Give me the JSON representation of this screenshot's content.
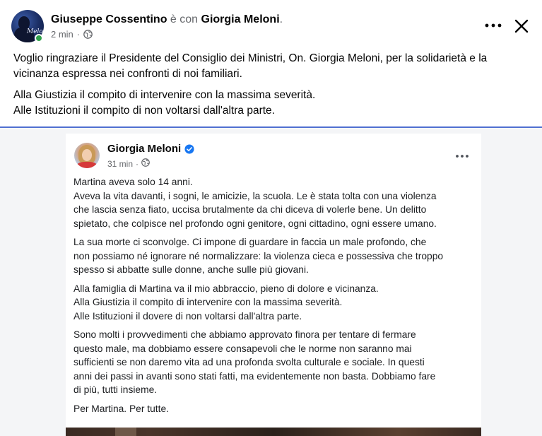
{
  "post": {
    "author": "Giuseppe Cossentino",
    "with_text": "è con",
    "tagged": "Giorgia Meloni",
    "period": ".",
    "time": "2 min",
    "dot": "·",
    "avatar_caption": "Meloni",
    "paragraphs": [
      "Voglio ringraziare il Presidente del Consiglio dei Ministri, On. Giorgia Meloni, per la solidarietà e la vicinanza espressa nei confronti di noi familiari.",
      "Alla Giustizia il compito di intervenire con la massima severità.",
      "Alle Istituzioni il compito di non voltarsi dall'altra parte."
    ]
  },
  "embed": {
    "author": "Giorgia Meloni",
    "time": "31 min",
    "dot": "·",
    "lines": {
      "p1": [
        "Martina aveva solo 14 anni.",
        "Aveva la vita davanti, i sogni, le amicizie, la scuola. Le è stata tolta con una violenza",
        "che lascia senza fiato, uccisa brutalmente da chi diceva di volerle bene. Un delitto",
        "spietato, che colpisce nel profondo ogni genitore, ogni cittadino, ogni essere umano."
      ],
      "p2": [
        "La sua morte ci sconvolge. Ci impone di guardare in faccia un male profondo, che",
        "non possiamo né ignorare né normalizzare: la violenza cieca e possessiva che troppo",
        "spesso si abbatte sulle donne, anche sulle più giovani."
      ],
      "p3": [
        "Alla famiglia di Martina va il mio abbraccio, pieno di dolore e vicinanza.",
        "Alla Giustizia il compito di intervenire con la massima severità.",
        "Alle Istituzioni il dovere di non voltarsi dall'altra parte."
      ],
      "p4": [
        "Sono molti i provvedimenti che abbiamo approvato finora per tentare di fermare",
        "questo male, ma dobbiamo essere consapevoli che le norme non saranno mai",
        "sufficienti se non daremo vita ad una profonda svolta culturale e sociale. In questi",
        "anni dei passi in avanti sono stati fatti, ma evidentemente non basta. Dobbiamo fare",
        "di più, tutti insieme."
      ],
      "p5": [
        "Per Martina. Per tutte."
      ]
    }
  },
  "icons": {
    "more": "more-horizontal-icon",
    "close": "close-icon",
    "audience": "globe-icon",
    "verified": "verified-badge-icon"
  },
  "colors": {
    "divider": "#4f6fd0",
    "verified": "#1877f2",
    "online": "#31a24c",
    "muted_text": "#65676b"
  }
}
